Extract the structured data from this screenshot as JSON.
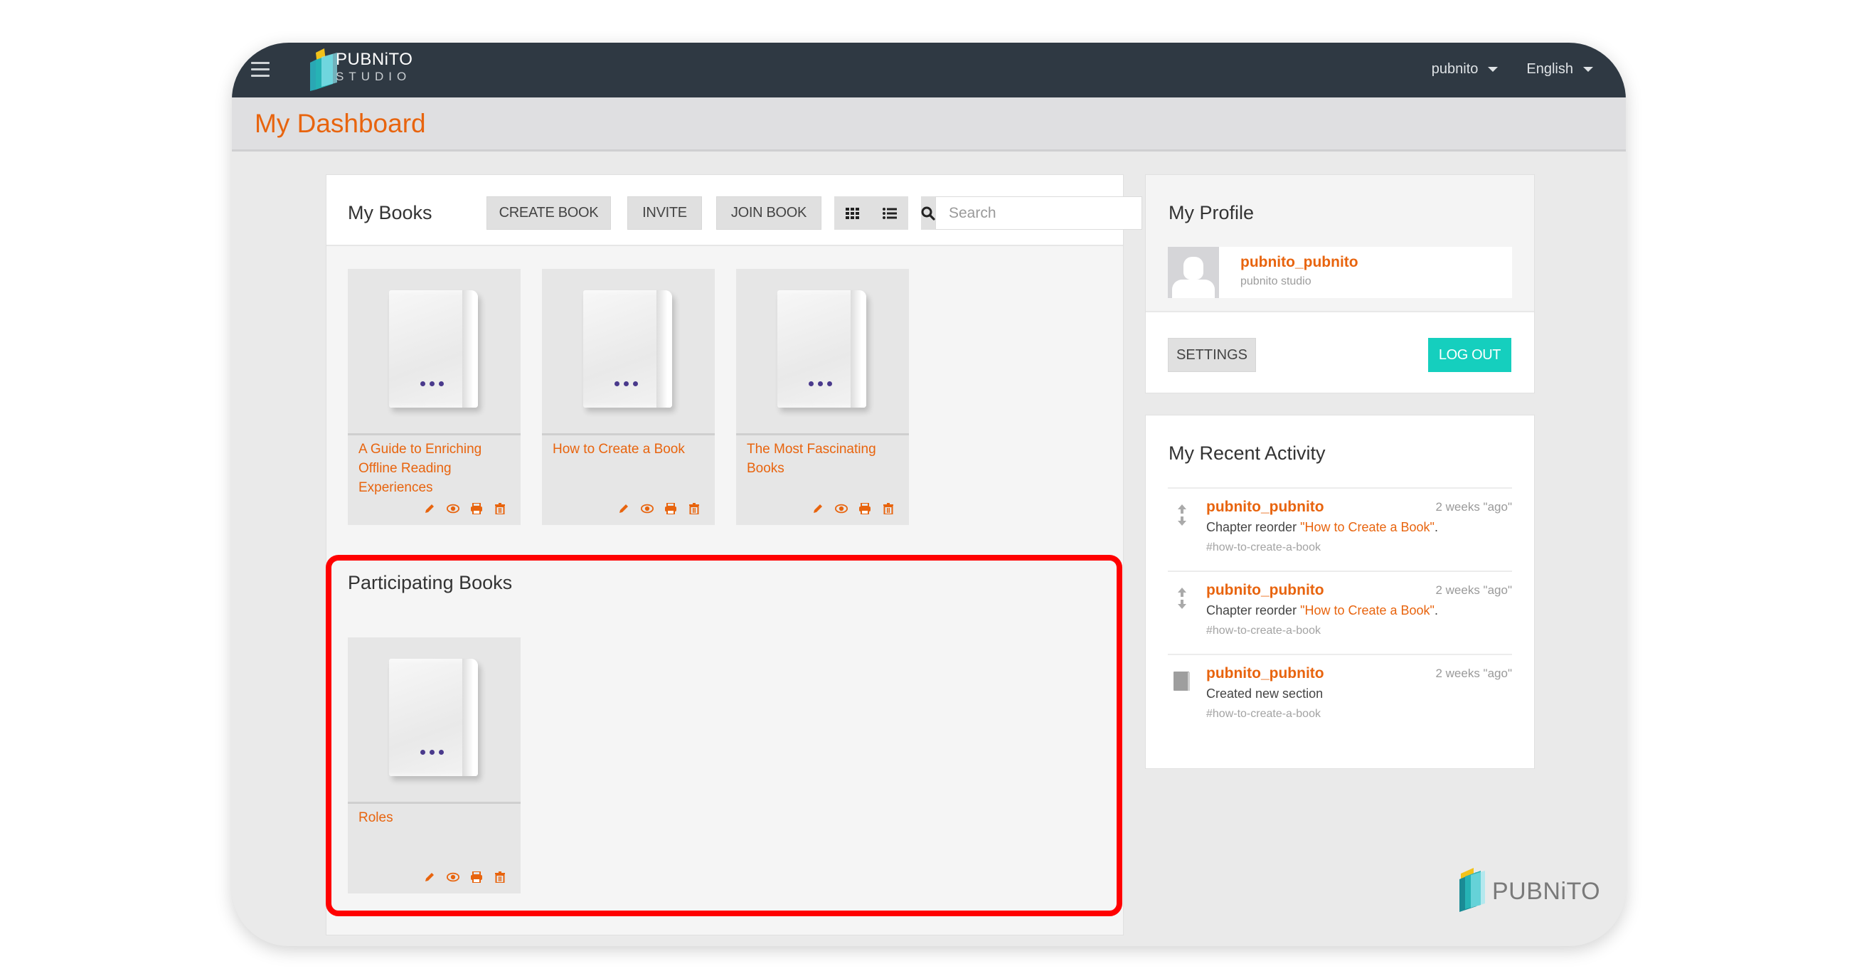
{
  "header": {
    "brand_line1": "PUBNiTO",
    "brand_line2": "STUDIO",
    "user_menu": "pubnito",
    "language_menu": "English"
  },
  "page": {
    "title": "My Dashboard"
  },
  "my_books": {
    "title": "My Books",
    "create_label": "CREATE BOOK",
    "invite_label": "INVITE",
    "join_label": "JOIN BOOK",
    "search_placeholder": "Search",
    "search_value": "",
    "books": [
      {
        "title": "A Guide to Enriching Offline Reading Experiences"
      },
      {
        "title": "How to Create a Book"
      },
      {
        "title": "The Most Fascinating Books"
      }
    ]
  },
  "participating_books": {
    "title": "Participating Books",
    "books": [
      {
        "title": "Roles"
      }
    ]
  },
  "profile": {
    "title": "My Profile",
    "username": "pubnito_pubnito",
    "subtitle": "pubnito studio",
    "settings_label": "SETTINGS",
    "logout_label": "LOG OUT"
  },
  "activity": {
    "title": "My Recent Activity",
    "items": [
      {
        "icon": "reorder-arrows-icon",
        "user": "pubnito_pubnito",
        "time": "2 weeks \"ago\"",
        "action": "Chapter reorder ",
        "link": "\"How to Create a Book\"",
        "suffix": ".",
        "tag": "#how-to-create-a-book"
      },
      {
        "icon": "reorder-arrows-icon",
        "user": "pubnito_pubnito",
        "time": "2 weeks \"ago\"",
        "action": "Chapter reorder ",
        "link": "\"How to Create a Book\"",
        "suffix": ".",
        "tag": "#how-to-create-a-book"
      },
      {
        "icon": "section-page-icon",
        "user": "pubnito_pubnito",
        "time": "2 weeks \"ago\"",
        "action": "Created new section",
        "link": "",
        "suffix": "",
        "tag": "#how-to-create-a-book"
      }
    ]
  },
  "footer": {
    "brand": "PUBNiTO"
  },
  "colors": {
    "accent_orange": "#e8640e",
    "topbar": "#2f3943",
    "logout_teal": "#15cfbe",
    "highlight_red": "#ff0000",
    "book_dots": "#4a3a8c"
  }
}
